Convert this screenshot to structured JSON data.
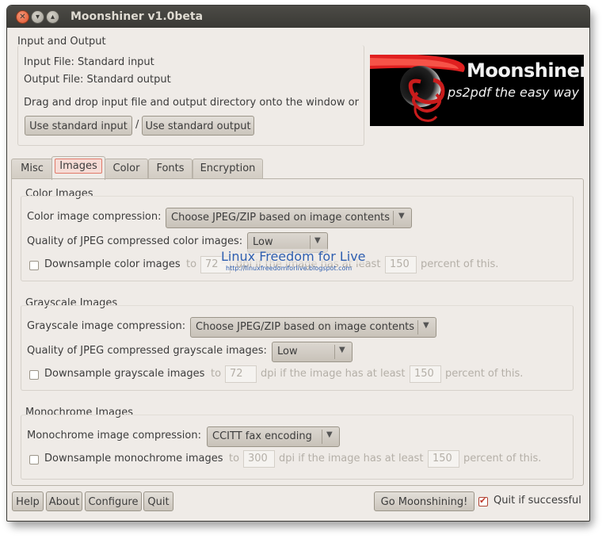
{
  "window": {
    "title": "Moonshiner v1.0beta"
  },
  "io": {
    "section_title": "Input and Output",
    "input_file": "Input File: Standard input",
    "output_file": "Output File: Standard output",
    "drag_hint": "Drag and drop input file and output directory onto the window or",
    "use_std_input": "Use standard input",
    "separator": "/",
    "use_std_output": "Use standard output"
  },
  "logo": {
    "name": "Moonshiner",
    "tagline": "ps2pdf the easy way"
  },
  "watermark": {
    "line1": "Linux Freedom for Live",
    "line2": "http://linuxfreedomforlive.blogspot.com"
  },
  "tabs": [
    {
      "label": "Misc"
    },
    {
      "label": "Images"
    },
    {
      "label": "Color"
    },
    {
      "label": "Fonts"
    },
    {
      "label": "Encryption"
    }
  ],
  "color_images": {
    "section_title": "Color Images",
    "compression_label": "Color image compression:",
    "compression_value": "Choose JPEG/ZIP based on image contents",
    "quality_label": "Quality of JPEG compressed color images:",
    "quality_value": "Low",
    "downsample_label": "Downsample color images",
    "to": "to",
    "dpi_value": "72",
    "dpi_text": "dpi if the image has at least",
    "percent_value": "150",
    "percent_text": "percent of this."
  },
  "grayscale_images": {
    "section_title": "Grayscale Images",
    "compression_label": "Grayscale image compression:",
    "compression_value": "Choose JPEG/ZIP based on image contents",
    "quality_label": "Quality of JPEG compressed grayscale images:",
    "quality_value": "Low",
    "downsample_label": "Downsample grayscale images",
    "to": "to",
    "dpi_value": "72",
    "dpi_text": "dpi if the image has at least",
    "percent_value": "150",
    "percent_text": "percent of this."
  },
  "mono_images": {
    "section_title": "Monochrome Images",
    "compression_label": "Monochrome image compression:",
    "compression_value": "CCITT fax encoding",
    "downsample_label": "Downsample monochrome images",
    "to": "to",
    "dpi_value": "300",
    "dpi_text": "dpi if the image has at least",
    "percent_value": "150",
    "percent_text": "percent of this."
  },
  "bottom": {
    "help": "Help",
    "about": "About",
    "configure": "Configure",
    "quit": "Quit",
    "go": "Go Moonshining!",
    "quit_if_successful": "Quit if successful"
  },
  "colors": {
    "titlebar": "#3c3b37",
    "window_bg": "#efebe7",
    "accent": "#e07b6b"
  }
}
